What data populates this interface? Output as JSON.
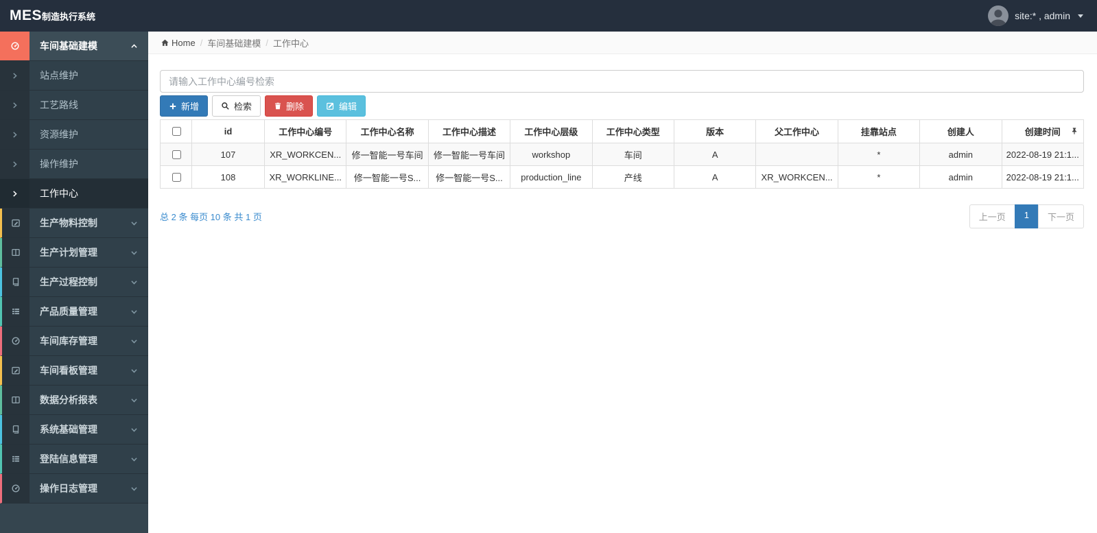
{
  "navbar": {
    "logo_bold": "MES",
    "logo_rest": "制造执行系统",
    "user_label": "site:* , admin"
  },
  "sidebar": {
    "items": [
      {
        "type": "parent",
        "icon": "gauge-icon",
        "label": "车间基础建模",
        "active": true,
        "expanded": true,
        "accent": "#f4705c",
        "accent_style": "fill"
      },
      {
        "type": "sub",
        "label": "站点维护"
      },
      {
        "type": "sub",
        "label": "工艺路线"
      },
      {
        "type": "sub",
        "label": "资源维护"
      },
      {
        "type": "sub",
        "label": "操作维护"
      },
      {
        "type": "sub",
        "label": "工作中心",
        "active": true
      },
      {
        "type": "parent",
        "icon": "pencil-square-icon",
        "label": "生产物料控制",
        "accent": "#f4c04e",
        "accent_style": "strip"
      },
      {
        "type": "parent",
        "icon": "columns-icon",
        "label": "生产计划管理",
        "accent": "#5fbe9e",
        "accent_style": "strip"
      },
      {
        "type": "parent",
        "icon": "book-icon",
        "label": "生产过程控制",
        "accent": "#4cc3e0",
        "accent_style": "strip"
      },
      {
        "type": "parent",
        "icon": "list-icon",
        "label": "产品质量管理",
        "accent": "#52c5b2",
        "accent_style": "strip"
      },
      {
        "type": "parent",
        "icon": "gauge-icon",
        "label": "车间库存管理",
        "accent": "#ee6e7c",
        "accent_style": "strip"
      },
      {
        "type": "parent",
        "icon": "pencil-square-icon",
        "label": "车间看板管理",
        "accent": "#f4c04e",
        "accent_style": "strip"
      },
      {
        "type": "parent",
        "icon": "columns-icon",
        "label": "数据分析报表",
        "accent": "#5fbe9e",
        "accent_style": "strip"
      },
      {
        "type": "parent",
        "icon": "book-icon",
        "label": "系统基础管理",
        "accent": "#4cc3e0",
        "accent_style": "strip"
      },
      {
        "type": "parent",
        "icon": "list-icon",
        "label": "登陆信息管理",
        "accent": "#52c5b2",
        "accent_style": "strip"
      },
      {
        "type": "parent",
        "icon": "gauge-icon",
        "label": "操作日志管理",
        "accent": "#ee6e7c",
        "accent_style": "strip"
      }
    ]
  },
  "breadcrumb": {
    "items": [
      {
        "label": "Home",
        "icon": "home-icon"
      },
      {
        "label": "车间基础建模"
      },
      {
        "label": "工作中心",
        "current": true
      }
    ]
  },
  "search": {
    "placeholder": "请输入工作中心编号检索"
  },
  "toolbar": {
    "buttons": [
      {
        "id": "add",
        "label": "新增",
        "icon": "plus-icon",
        "bg": "#337ab7",
        "fg": "#ffffff",
        "border": "#2e6da4"
      },
      {
        "id": "search",
        "label": "检索",
        "icon": "search-icon",
        "bg": "#ffffff",
        "fg": "#333333",
        "border": "#cccccc"
      },
      {
        "id": "delete",
        "label": "删除",
        "icon": "trash-icon",
        "bg": "#d9534f",
        "fg": "#ffffff",
        "border": "#d43f3a"
      },
      {
        "id": "edit",
        "label": "编辑",
        "icon": "edit-icon",
        "bg": "#5bc0de",
        "fg": "#ffffff",
        "border": "#46b8da"
      }
    ]
  },
  "table": {
    "has_checkbox_column": true,
    "pin_icon": "pin-icon",
    "headers": [
      "id",
      "工作中心编号",
      "工作中心名称",
      "工作中心描述",
      "工作中心层级",
      "工作中心类型",
      "版本",
      "父工作中心",
      "挂靠站点",
      "创建人",
      "创建时间"
    ],
    "rows": [
      [
        "107",
        "XR_WORKCEN...",
        "修一智能一号车间",
        "修一智能一号车间",
        "workshop",
        "车间",
        "A",
        "",
        "*",
        "admin",
        "2022-08-19 21:1..."
      ],
      [
        "108",
        "XR_WORKLINE...",
        "修一智能一号S...",
        "修一智能一号S...",
        "production_line",
        "产线",
        "A",
        "XR_WORKCEN...",
        "*",
        "admin",
        "2022-08-19 21:1..."
      ]
    ]
  },
  "pagination": {
    "summary": "总 2 条  每页 10 条  共 1 页",
    "prev_label": "上一页",
    "page": "1",
    "next_label": "下一页"
  }
}
